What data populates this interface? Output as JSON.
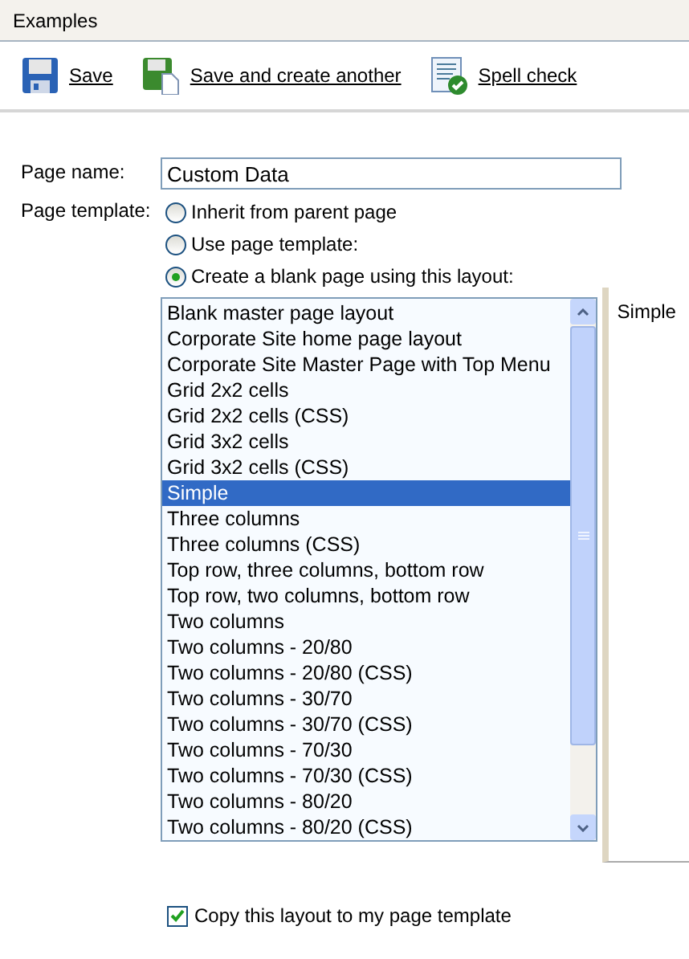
{
  "header": {
    "title": "Examples"
  },
  "toolbar": [
    {
      "label": "Save",
      "kind": "save"
    },
    {
      "label": "Save and create another",
      "kind": "save_another"
    },
    {
      "label": "Spell check",
      "kind": "spell"
    }
  ],
  "form": {
    "page_name": {
      "label": "Page name:",
      "value": "Custom Data"
    },
    "page_template": {
      "label": "Page template:",
      "options": [
        {
          "label": "Inherit from parent page",
          "selected": false
        },
        {
          "label": "Use page template:",
          "selected": false
        },
        {
          "label": "Create a blank page using this layout:",
          "selected": true
        }
      ]
    },
    "layouts": [
      {
        "label": "Blank master page layout",
        "selected": false
      },
      {
        "label": "Corporate Site home page layout",
        "selected": false
      },
      {
        "label": "Corporate Site Master Page with Top Menu",
        "selected": false
      },
      {
        "label": "Grid 2x2 cells",
        "selected": false
      },
      {
        "label": "Grid 2x2 cells (CSS)",
        "selected": false
      },
      {
        "label": "Grid 3x2 cells",
        "selected": false
      },
      {
        "label": "Grid 3x2 cells (CSS)",
        "selected": false
      },
      {
        "label": "Simple",
        "selected": true
      },
      {
        "label": "Three columns",
        "selected": false
      },
      {
        "label": "Three columns (CSS)",
        "selected": false
      },
      {
        "label": "Top row, three columns, bottom row",
        "selected": false
      },
      {
        "label": "Top row, two columns, bottom row",
        "selected": false
      },
      {
        "label": "Two columns",
        "selected": false
      },
      {
        "label": "Two columns - 20/80",
        "selected": false
      },
      {
        "label": "Two columns - 20/80 (CSS)",
        "selected": false
      },
      {
        "label": "Two columns - 30/70",
        "selected": false
      },
      {
        "label": "Two columns - 30/70 (CSS)",
        "selected": false
      },
      {
        "label": "Two columns - 70/30",
        "selected": false
      },
      {
        "label": "Two columns - 70/30 (CSS)",
        "selected": false
      },
      {
        "label": "Two columns - 80/20",
        "selected": false
      },
      {
        "label": "Two columns - 80/20 (CSS)",
        "selected": false
      }
    ],
    "preview": {
      "text": "Simple"
    },
    "copy_layout": {
      "label": "Copy this layout to my page template",
      "checked": true
    }
  }
}
